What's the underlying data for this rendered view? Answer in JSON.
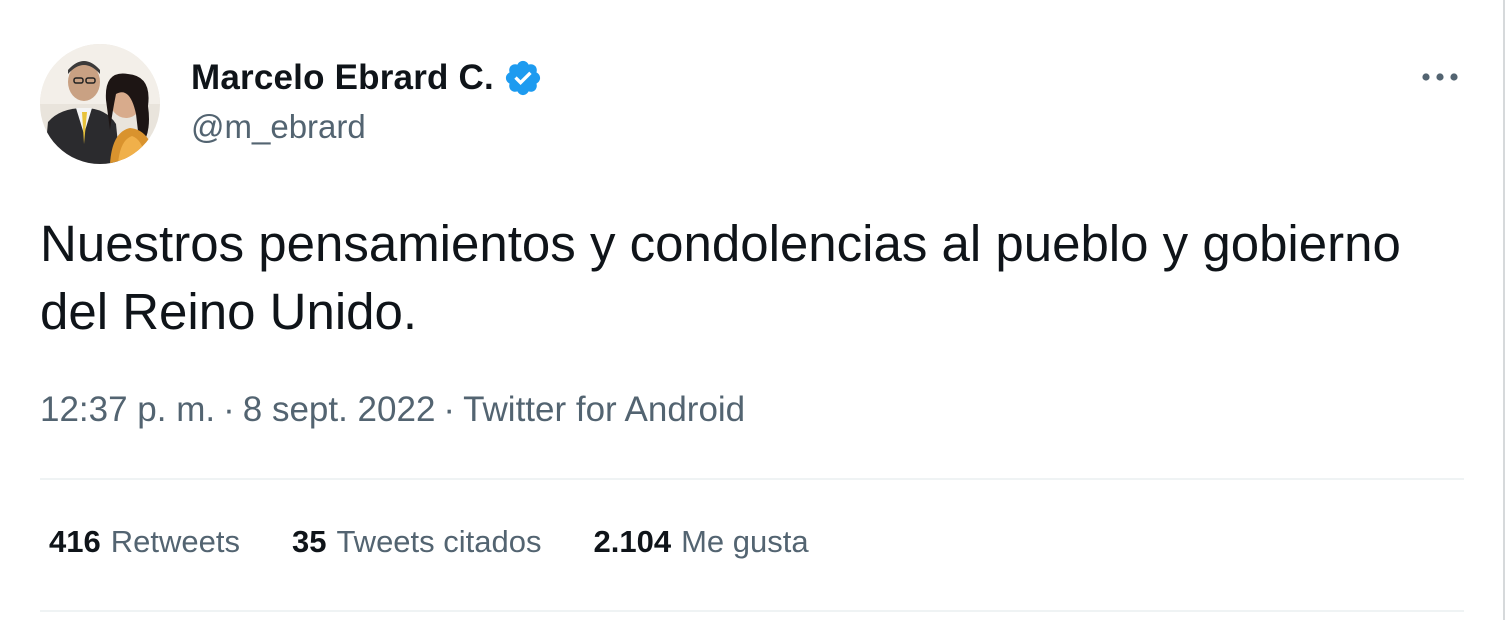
{
  "author": {
    "display_name": "Marcelo Ebrard C.",
    "handle": "@m_ebrard",
    "verified": true,
    "avatar_icon": "profile-photo"
  },
  "tweet": {
    "text": "Nuestros pensamientos y condolencias al pueblo y gobierno del Reino Unido.",
    "time": "12:37 p. m.",
    "date": "8 sept. 2022",
    "source": "Twitter for Android",
    "separator": "·"
  },
  "stats": {
    "retweets_count": "416",
    "retweets_label": "Retweets",
    "quotes_count": "35",
    "quotes_label": "Tweets citados",
    "likes_count": "2.104",
    "likes_label": "Me gusta"
  },
  "colors": {
    "text_primary": "#0f1419",
    "text_secondary": "#536471",
    "verified_blue": "#1d9bf0",
    "divider": "#eff3f4"
  },
  "icons": {
    "verified": "verified-badge-icon",
    "more": "more-options-icon"
  }
}
